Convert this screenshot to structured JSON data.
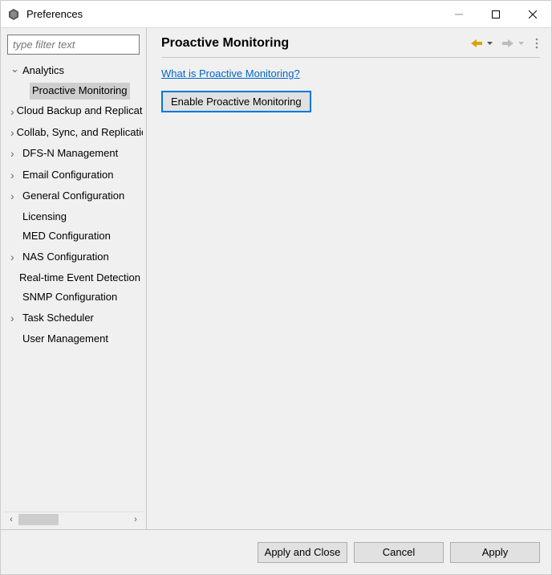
{
  "window": {
    "title": "Preferences"
  },
  "filter": {
    "placeholder": "type filter text"
  },
  "tree": {
    "items": [
      {
        "label": "Analytics",
        "expanded": true,
        "hasChildren": true
      },
      {
        "label": "Proactive Monitoring",
        "child": true,
        "selected": true
      },
      {
        "label": "Cloud Backup and Replication",
        "hasChildren": true
      },
      {
        "label": "Collab, Sync, and Replication",
        "hasChildren": true
      },
      {
        "label": "DFS-N Management",
        "hasChildren": true
      },
      {
        "label": "Email Configuration",
        "hasChildren": true
      },
      {
        "label": "General Configuration",
        "hasChildren": true
      },
      {
        "label": "Licensing"
      },
      {
        "label": "MED Configuration"
      },
      {
        "label": "NAS Configuration",
        "hasChildren": true
      },
      {
        "label": "Real-time Event Detection"
      },
      {
        "label": "SNMP Configuration"
      },
      {
        "label": "Task Scheduler",
        "hasChildren": true
      },
      {
        "label": "User Management"
      }
    ]
  },
  "main": {
    "title": "Proactive Monitoring",
    "helpLink": "What is Proactive Monitoring?",
    "enableButton": "Enable Proactive Monitoring"
  },
  "buttons": {
    "applyClose": "Apply and Close",
    "cancel": "Cancel",
    "apply": "Apply"
  }
}
